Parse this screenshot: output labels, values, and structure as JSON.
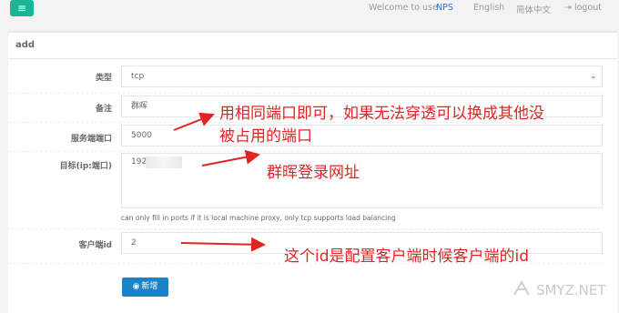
{
  "topbar": {
    "welcome": "Welcome to use",
    "brand": "NPS",
    "lang_en": "English",
    "lang_cn": "简体中文",
    "logout": "logout"
  },
  "card": {
    "title": "add"
  },
  "form": {
    "type_label": "类型",
    "type_value": "tcp",
    "remark_label": "备注",
    "remark_value": "群晖",
    "server_port_label": "服务端端口",
    "server_port_value": "5000",
    "target_label": "目标(ip:端口)",
    "target_value": "192.           5:5000",
    "target_help": "can only fill in ports if it is local machine proxy, only tcp supports load balancing",
    "client_id_label": "客户端id",
    "client_id_value": "2",
    "add_button": "新增"
  },
  "annotations": {
    "a1_line1": "用相同端口即可，如果无法穿透可以换成其他没",
    "a1_line2": "被占用的端口",
    "a2": "群晖登录网址",
    "a3": "这个id是配置客户端时候客户端的id"
  },
  "watermark": "SMYZ.NET",
  "colors": {
    "accent": "#1ab394",
    "primary": "#1c84c6",
    "annotation": "#e02424"
  }
}
